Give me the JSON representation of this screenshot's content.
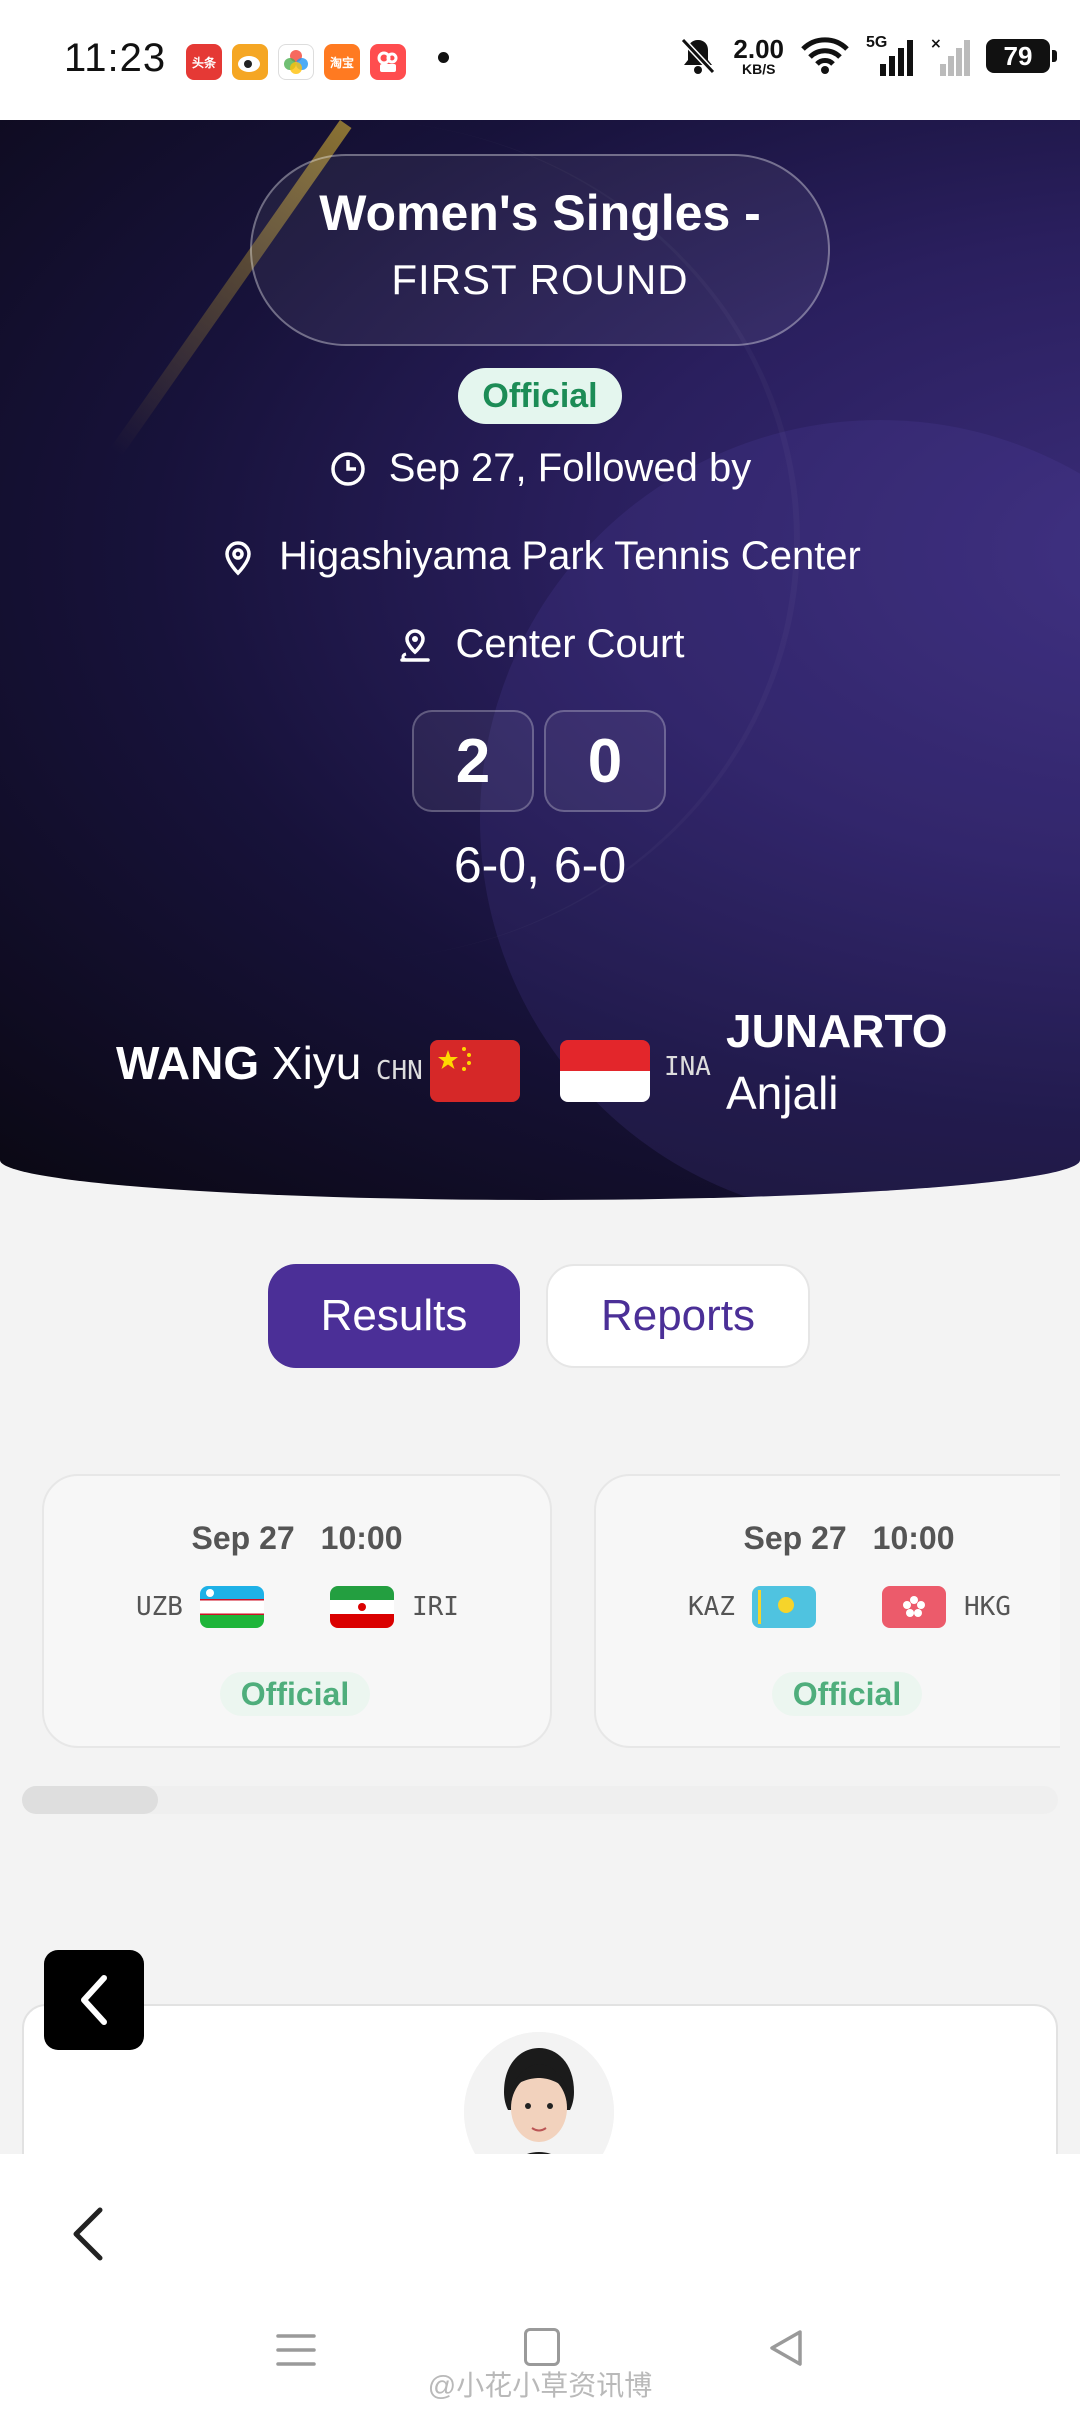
{
  "status_bar": {
    "time": "11:23",
    "apps": [
      {
        "name": "toutiao-icon",
        "label": "头条",
        "color": "#e53935"
      },
      {
        "name": "weibo-icon",
        "label": "",
        "color": "#f5a623"
      },
      {
        "name": "photos-icon",
        "label": "",
        "color": "#8e6bd8"
      },
      {
        "name": "taobao-icon",
        "label": "淘宝",
        "color": "#ff7a21"
      },
      {
        "name": "kuaishou-icon",
        "label": "",
        "color": "#ff4d4f"
      }
    ],
    "net_speed": "2.00",
    "net_unit": "KB/S",
    "signal_label": "5G",
    "battery": "79"
  },
  "hero": {
    "event_title": "Women's Singles  -",
    "round": "FIRST ROUND",
    "status": "Official",
    "date_text": "Sep 27, Followed by",
    "venue": "Higashiyama Park Tennis Center",
    "court": "Center Court",
    "score_home": "2",
    "score_away": "0",
    "set_scores": "6-0, 6-0",
    "player1": {
      "last": "WANG",
      "first": "Xiyu",
      "noc": "CHN"
    },
    "player2": {
      "last": "JUNARTO",
      "first": "Anjali",
      "noc": "INA"
    }
  },
  "tabs": {
    "results": "Results",
    "reports": "Reports"
  },
  "matches": [
    {
      "date": "Sep 27",
      "time": "10:00",
      "home": "UZB",
      "away": "IRI",
      "status": "Official"
    },
    {
      "date": "Sep 27",
      "time": "10:00",
      "home": "KAZ",
      "away": "HKG",
      "status": "Official"
    }
  ],
  "watermark": "@小花小草资讯博",
  "colors": {
    "accent": "#4b2f97",
    "official_green": "#1c8c56"
  }
}
